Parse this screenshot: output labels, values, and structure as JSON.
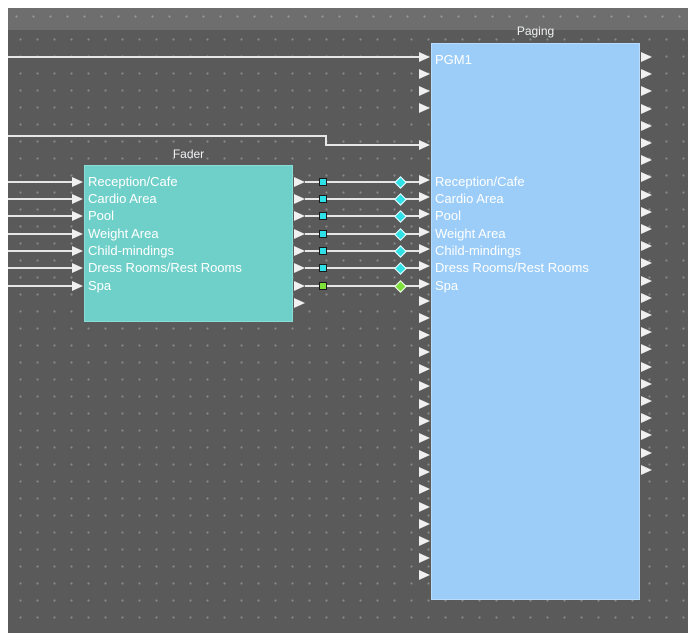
{
  "paging": {
    "title": "Paging",
    "inputs": [
      "PGM1",
      "Reception/Cafe",
      "Cardio Area",
      "Pool",
      "Weight Area",
      "Child-mindings",
      "Dress Rooms/Rest Rooms",
      "Spa"
    ]
  },
  "fader": {
    "title": "Fader",
    "inputs": [
      "Reception/Cafe",
      "Cardio Area",
      "Pool",
      "Weight Area",
      "Child-mindings",
      "Dress Rooms/Rest Rooms",
      "Spa"
    ]
  },
  "colors": {
    "canvas": "#5a5a5a",
    "paging_block": "#9ccdf8",
    "fader_block": "#6fcfc9",
    "connector_cyan": "#2fe0e6",
    "connector_green": "#7ee03a"
  }
}
